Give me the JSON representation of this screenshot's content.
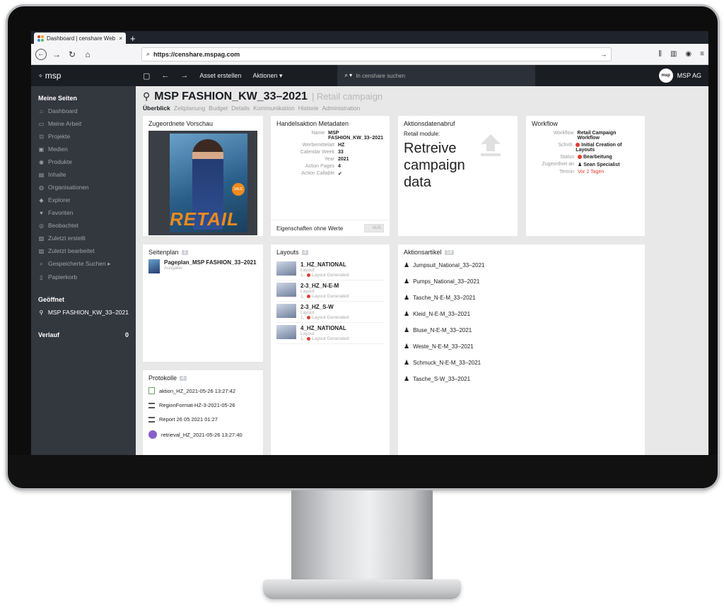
{
  "browser": {
    "tab_title": "Dashboard | censhare Web",
    "tab_close": "×",
    "new_tab": "+",
    "url": "https://censhare.mspag.com"
  },
  "app": {
    "logo_text": "msp",
    "toolbar": {
      "asset_create": "Asset erstellen",
      "actions": "Aktionen ▾",
      "search_placeholder": "In censhare suchen"
    },
    "user_name": "MSP AG",
    "user_avatar": "msp"
  },
  "sidebar": {
    "section_my_pages": "Meine Seiten",
    "items": [
      {
        "label": "Dashboard",
        "icon": "⌂"
      },
      {
        "label": "Meine Arbeit",
        "icon": "▭"
      },
      {
        "label": "Projekte",
        "icon": "⊡"
      },
      {
        "label": "Medien",
        "icon": "▣"
      },
      {
        "label": "Produkte",
        "icon": "◉"
      },
      {
        "label": "Inhalte",
        "icon": "▤"
      },
      {
        "label": "Organisationen",
        "icon": "◍"
      },
      {
        "label": "Explorer",
        "icon": "◆"
      },
      {
        "label": "Favoriten",
        "icon": "♥"
      },
      {
        "label": "Beobachtet",
        "icon": "◎"
      },
      {
        "label": "Zuletzt erstellt",
        "icon": "▨"
      },
      {
        "label": "Zuletzt bearbeitet",
        "icon": "▨"
      },
      {
        "label": "Gespeicherte Suchen ▸",
        "icon": "⌕"
      },
      {
        "label": "Papierkorb",
        "icon": "▯"
      }
    ],
    "section_open": "Geöffnet",
    "open_item": "MSP FASHION_KW_33–2021",
    "history_label": "Verlauf",
    "history_count": "0"
  },
  "page": {
    "title": "MSP FASHION_KW_33–2021",
    "subtitle": "| Retail campaign",
    "tabs": [
      "Überblick",
      "Zeitplanung",
      "Budget",
      "Details",
      "Kommunikation",
      "Historie",
      "Administration"
    ]
  },
  "cards": {
    "preview": {
      "title": "Zugeordnete Vorschau",
      "poster_text": "RETAIL",
      "poster_sale": "SALE"
    },
    "meta": {
      "title": "Handelsaktion Metadaten",
      "rows": [
        {
          "k": "Name",
          "v": "MSP FASHION_KW_33–2021"
        },
        {
          "k": "Werbemittelart",
          "v": "HZ"
        },
        {
          "k": "Calendar Week",
          "v": "33"
        },
        {
          "k": "Year",
          "v": "2021"
        },
        {
          "k": "Action Pages",
          "v": "4"
        },
        {
          "k": "Action Callable",
          "v": "✔"
        }
      ],
      "toggle_label": "Eigenschaften ohne Werte",
      "toggle_state": "AUS"
    },
    "retrieve": {
      "title": "Aktionsdatenabruf",
      "module_label": "Retail module:",
      "big_text": "Retreive campaign data"
    },
    "workflow": {
      "title": "Workflow",
      "workflow_k": "Workflow",
      "workflow_v": "Retail Campaign Workflow",
      "step_k": "Schritt",
      "step_v": "Initial Creation of Layouts",
      "status_k": "Status",
      "status_v": "Bearbeitung",
      "assigned_k": "Zugeordnet an",
      "assigned_v": "Sean Specialist",
      "due_k": "Termin",
      "due_v": "Vor 2 Tagen"
    },
    "pageplan": {
      "title": "Seitenplan",
      "count": "1",
      "item_name": "Pageplan_MSP FASHION_33–2021",
      "item_sub": "Ausgabe"
    },
    "layouts": {
      "title": "Layouts",
      "count": "4",
      "items": [
        {
          "name": "1_HZ_NATIONAL",
          "type": "Layout",
          "meta": "1, ",
          "status": "Layout Generated"
        },
        {
          "name": "2-3_HZ_N-E-M",
          "type": "Layout",
          "meta": "1, ",
          "status": "Layout Generated"
        },
        {
          "name": "2-3_HZ_S-W",
          "type": "Layout",
          "meta": "1, ",
          "status": "Layout Generated"
        },
        {
          "name": "4_HZ_NATIONAL",
          "type": "Layout",
          "meta": "1, ",
          "status": "Layout Generated"
        }
      ]
    },
    "articles": {
      "title": "Aktionsartikel",
      "count": "18",
      "items": [
        "Jumpsuit_National_33–2021",
        "Pumps_National_33–2021",
        "Tasche_N-E-M_33–2021",
        "Kleid_N-E-M_33–2021",
        "Bluse_N-E-M_33–2021",
        "Weste_N-E-M_33–2021",
        "Schmuck_N-E-M_33–2021",
        "Tasche_S-W_33–2021"
      ]
    },
    "protocols": {
      "title": "Protokolle",
      "count": "4",
      "items": [
        "aktion_HZ_2021-05-26 13:27:42",
        "RegionFormat-HZ-3-2021-05-26",
        "Report 26 05 2021 01:27",
        "retrieval_HZ_2021-05-26 13:27:40"
      ]
    }
  }
}
